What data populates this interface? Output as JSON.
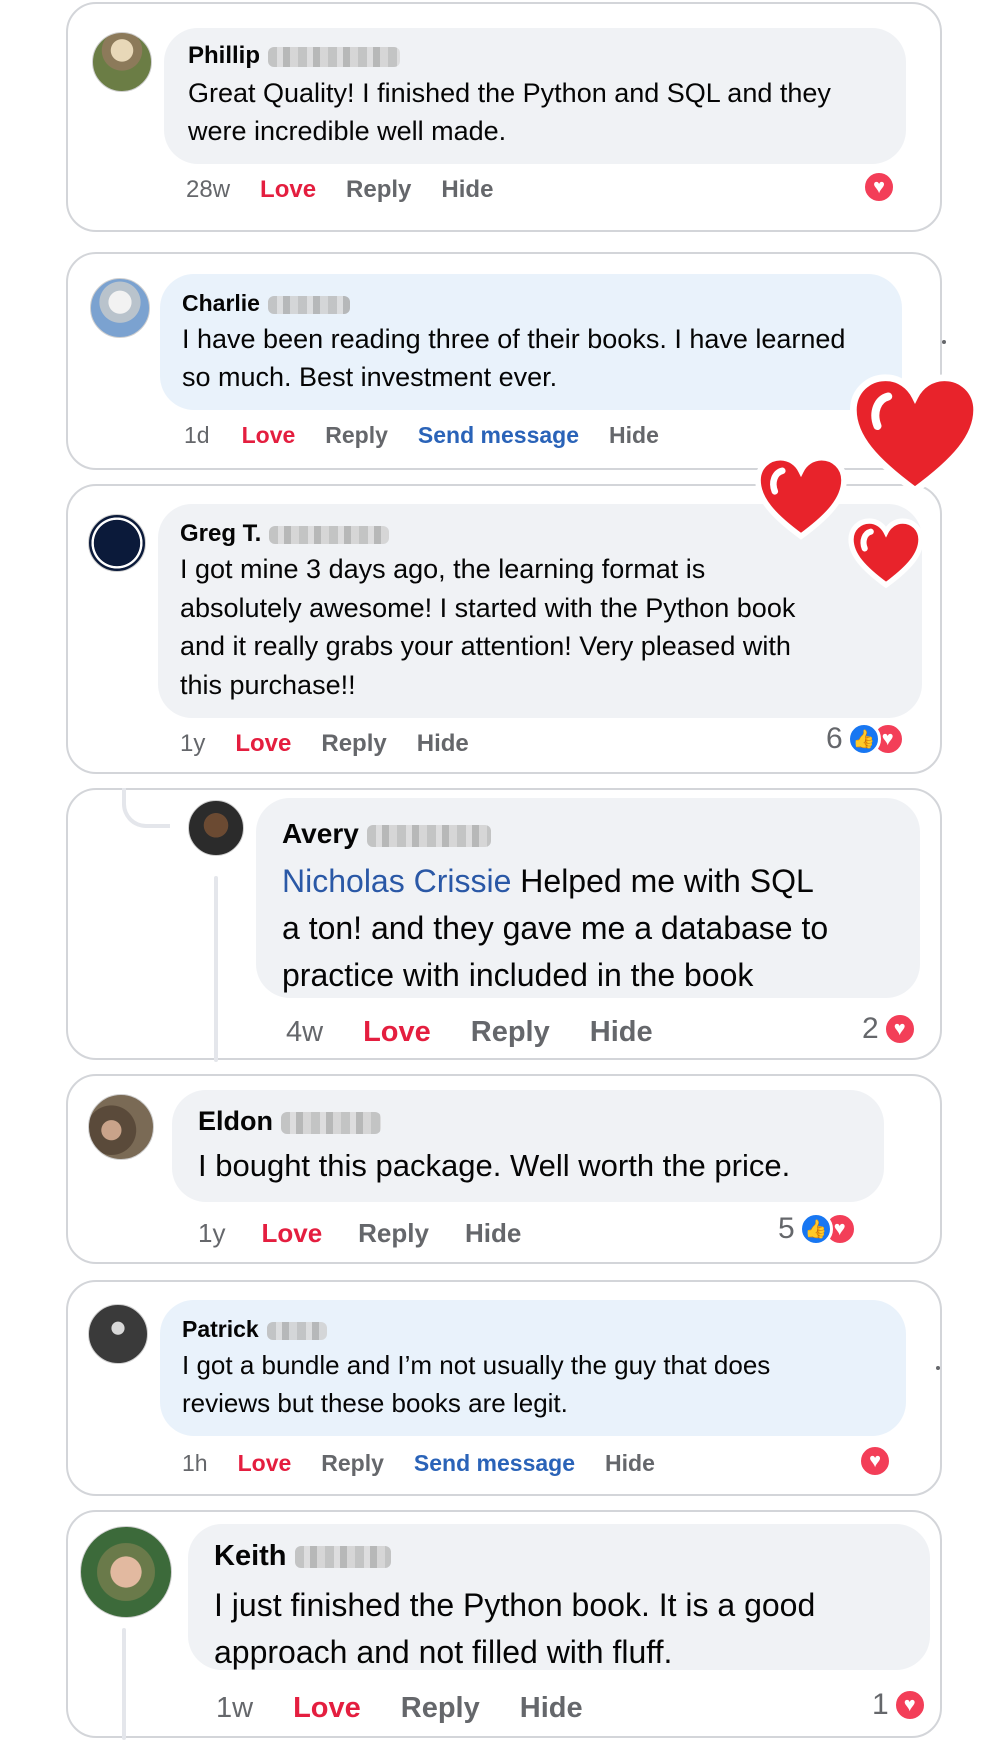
{
  "colors": {
    "love": "#e41e3f",
    "link": "#2a63b8",
    "mention": "#2a58a6",
    "meta": "#65676b",
    "bubble_gray": "#f0f2f5",
    "bubble_blue": "#e9f2fb",
    "like_blue": "#1877f2",
    "heart_red": "#f33e58",
    "decor_heart": "#e8232b"
  },
  "comments": [
    {
      "name": "Phillip",
      "text_lines": [
        "Great Quality! I finished the Python and SQL and they",
        "were incredible well made."
      ],
      "time": "28w",
      "actions": [
        "Love",
        "Reply",
        "Hide"
      ],
      "reaction_count": "",
      "reactions": [
        "heart-icon"
      ]
    },
    {
      "name": "Charlie",
      "text_lines": [
        "I have been reading three of their books. I have learned",
        "so much. Best investment ever."
      ],
      "time": "1d",
      "actions": [
        "Love",
        "Reply",
        "Send message",
        "Hide"
      ],
      "reaction_count": "",
      "reactions": []
    },
    {
      "name": "Greg T.",
      "text_lines": [
        "I got mine 3 days ago, the learning format is",
        "absolutely awesome! I started with the Python book",
        "and it really grabs your attention! Very pleased with",
        "this purchase!!"
      ],
      "time": "1y",
      "actions": [
        "Love",
        "Reply",
        "Hide"
      ],
      "reaction_count": "6",
      "reactions": [
        "like-icon",
        "heart-icon"
      ]
    },
    {
      "name": "Avery",
      "mention": "Nicholas Crissie",
      "text_lines": [
        " Helped me with SQL",
        "a ton! and they gave me a database to",
        "practice with included in the book"
      ],
      "time": "4w",
      "actions": [
        "Love",
        "Reply",
        "Hide"
      ],
      "reaction_count": "2",
      "reactions": [
        "heart-icon"
      ]
    },
    {
      "name": "Eldon",
      "text_lines": [
        "I bought this package. Well worth the price."
      ],
      "time": "1y",
      "actions": [
        "Love",
        "Reply",
        "Hide"
      ],
      "reaction_count": "5",
      "reactions": [
        "like-icon",
        "heart-icon"
      ]
    },
    {
      "name": "Patrick",
      "text_lines": [
        "I got a bundle and I’m not usually the guy that does",
        "reviews but these books are legit."
      ],
      "time": "1h",
      "actions": [
        "Love",
        "Reply",
        "Send message",
        "Hide"
      ],
      "reaction_count": "",
      "reactions": [
        "heart-icon"
      ]
    },
    {
      "name": "Keith",
      "text_lines": [
        "I just finished the Python book. It is a good",
        "approach and not filled with fluff."
      ],
      "time": "1w",
      "actions": [
        "Love",
        "Reply",
        "Hide"
      ],
      "reaction_count": "1",
      "reactions": [
        "heart-icon"
      ]
    }
  ]
}
